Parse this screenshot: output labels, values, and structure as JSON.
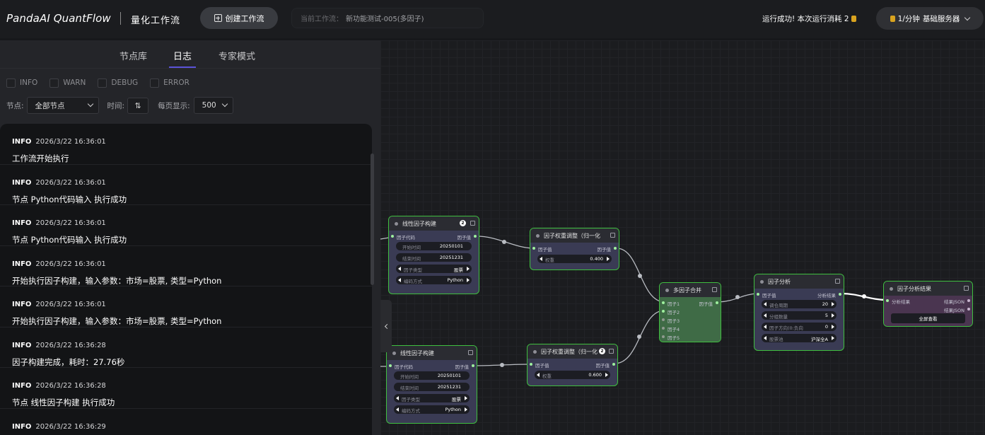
{
  "header": {
    "logo": "PandaAI QuantFlow",
    "subtitle": "量化工作流",
    "create_button": "创建工作流",
    "current_workflow_label": "当前工作流：",
    "current_workflow_value": "新功能测试-005(多因子)",
    "run_status": "运行成功! 本次运行消耗 2",
    "pricing": "1/分钟",
    "server": "基础服务器"
  },
  "left_panel": {
    "tabs": [
      {
        "label": "节点库",
        "active": false
      },
      {
        "label": "日志",
        "active": true
      },
      {
        "label": "专家模式",
        "active": false
      }
    ],
    "filters": [
      "INFO",
      "WARN",
      "DEBUG",
      "ERROR"
    ],
    "node_label": "节点:",
    "node_select": "全部节点",
    "time_label": "时间:",
    "per_page_label": "每页显示:",
    "per_page_value": "500",
    "logs": [
      {
        "level": "INFO",
        "time": "2026/3/22 16:36:01",
        "message": "工作流开始执行"
      },
      {
        "level": "INFO",
        "time": "2026/3/22 16:36:01",
        "message": "节点 Python代码输入 执行成功"
      },
      {
        "level": "INFO",
        "time": "2026/3/22 16:36:01",
        "message": "节点 Python代码输入 执行成功"
      },
      {
        "level": "INFO",
        "time": "2026/3/22 16:36:01",
        "message": "开始执行因子构建，输入参数：市场=股票, 类型=Python"
      },
      {
        "level": "INFO",
        "time": "2026/3/22 16:36:01",
        "message": "开始执行因子构建，输入参数：市场=股票, 类型=Python"
      },
      {
        "level": "INFO",
        "time": "2026/3/22 16:36:28",
        "message": "因子构建完成，耗时：27.76秒"
      },
      {
        "level": "INFO",
        "time": "2026/3/22 16:36:28",
        "message": "节点 线性因子构建 执行成功"
      },
      {
        "level": "INFO",
        "time": "2026/3/22 16:36:29",
        "message": ""
      }
    ]
  },
  "nodes": {
    "factor1": {
      "title": "线性因子构建",
      "badge": "2",
      "input": "因子代码",
      "output": "因子值",
      "fields": [
        {
          "key": "开始时间",
          "value": "20250101"
        },
        {
          "key": "结束时间",
          "value": "20251231"
        },
        {
          "key": "因子类型",
          "value": "股票"
        },
        {
          "key": "编码方式",
          "value": "Python"
        }
      ]
    },
    "factor2": {
      "title": "线性因子构建",
      "input": "因子代码",
      "output": "因子值",
      "fields": [
        {
          "key": "开始时间",
          "value": "20250101"
        },
        {
          "key": "结束时间",
          "value": "20251231"
        },
        {
          "key": "因子类型",
          "value": "股票"
        },
        {
          "key": "编码方式",
          "value": "Python"
        }
      ]
    },
    "weight1": {
      "title": "因子权重调整（归一化",
      "input": "因子值",
      "output": "因子值",
      "field": {
        "key": "权重",
        "value": "0.400"
      }
    },
    "weight2": {
      "title": "因子权重调整（归一化",
      "badge": "2",
      "input": "因子值",
      "output": "因子值",
      "field": {
        "key": "权重",
        "value": "0.600"
      }
    },
    "merge": {
      "title": "多因子合并",
      "output": "因子值",
      "inputs": [
        "因子1",
        "因子2",
        "因子3",
        "因子4",
        "因子5"
      ]
    },
    "analysis": {
      "title": "因子分析",
      "input": "因子值",
      "output": "分析结果",
      "fields": [
        {
          "key": "调仓周期",
          "value": "20"
        },
        {
          "key": "分组数量",
          "value": "5"
        },
        {
          "key": "因子方向(0:负向",
          "value": "0"
        },
        {
          "key": "股票池",
          "value": "沪深全A"
        }
      ]
    },
    "result": {
      "title": "因子分析结果",
      "input": "分析结果",
      "outputs": [
        "结果JSON",
        "结果JSON"
      ],
      "button": "全屏查看"
    }
  },
  "colors": {
    "accent": "#5b52d8",
    "node_border": "#3fbf3f",
    "coin": "#d9a31f"
  }
}
